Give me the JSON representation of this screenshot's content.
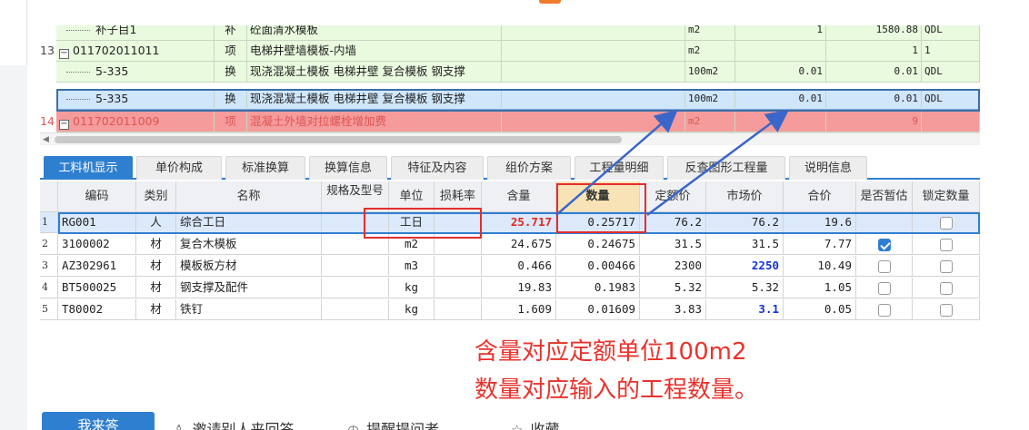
{
  "upper_rows": [
    {
      "num": "",
      "code": "补子目1",
      "type": "补",
      "name": "砼面清水模板",
      "unit": "m2",
      "qty_exp": "1",
      "qty": "1580.88",
      "extra": "QDL",
      "style": "green",
      "indent": true
    },
    {
      "num": "13",
      "code": "011702011011",
      "type": "项",
      "name": "电梯井壁墙模板-内墙",
      "unit": "m2",
      "qty_exp": "",
      "qty": "1",
      "extra": "1",
      "style": "green",
      "tree": true
    },
    {
      "num": "",
      "code": "5-335",
      "type": "换",
      "name": "现浇混凝土模板 电梯井壁 复合模板 钢支撑",
      "unit": "100m2",
      "qty_exp": "0.01",
      "qty": "0.01",
      "extra": "QDL",
      "style": "green",
      "indent": true
    },
    {
      "num": "",
      "code": "5-335",
      "type": "换",
      "name": "现浇混凝土模板 电梯井壁 复合模板 钢支撑",
      "unit": "100m2",
      "qty_exp": "0.01",
      "qty": "0.01",
      "extra": "QDL",
      "style": "sel",
      "indent": true
    },
    {
      "num": "14",
      "code": "011702011009",
      "type": "项",
      "name": "混凝土外墙对拉螺栓增加费",
      "unit": "m2",
      "qty_exp": "",
      "qty": "9",
      "extra": "",
      "style": "red",
      "tree": true
    }
  ],
  "tabs": [
    "工料机显示",
    "单价构成",
    "标准换算",
    "换算信息",
    "特征及内容",
    "组价方案",
    "工程量明细",
    "反查图形工程量",
    "说明信息"
  ],
  "table": {
    "headers": {
      "code": "编码",
      "cat": "类别",
      "name": "名称",
      "spec": "规格及型号",
      "unit": "单位",
      "loss": "损耗率",
      "content": "含量",
      "qty": "数量",
      "quota": "定额价",
      "market": "市场价",
      "total": "合价",
      "temp": "是否暂估",
      "lock": "锁定数量"
    },
    "rows": [
      {
        "idx": "1",
        "code": "RG001",
        "cat": "人",
        "name": "综合工日",
        "unit": "工日",
        "content": "25.717",
        "qty": "0.25717",
        "quota": "76.2",
        "market": "76.2",
        "total": "19.6",
        "temp": null,
        "lock": false
      },
      {
        "idx": "2",
        "code": "3100002",
        "cat": "材",
        "name": "复合木模板",
        "unit": "m2",
        "content": "24.675",
        "qty": "0.24675",
        "quota": "31.5",
        "market": "31.5",
        "total": "7.77",
        "temp": true,
        "lock": false
      },
      {
        "idx": "3",
        "code": "AZ302961",
        "cat": "材",
        "name": "模板板方材",
        "unit": "m3",
        "content": "0.466",
        "qty": "0.00466",
        "quota": "2300",
        "market": "2250",
        "total": "10.49",
        "temp": false,
        "lock": false
      },
      {
        "idx": "4",
        "code": "BT500025",
        "cat": "材",
        "name": "钢支撑及配件",
        "unit": "kg",
        "content": "19.83",
        "qty": "0.1983",
        "quota": "5.32",
        "market": "5.32",
        "total": "1.05",
        "temp": false,
        "lock": false
      },
      {
        "idx": "5",
        "code": "T80002",
        "cat": "材",
        "name": "铁钉",
        "unit": "kg",
        "content": "1.609",
        "qty": "0.01609",
        "quota": "3.83",
        "market": "3.1",
        "total": "0.05",
        "temp": false,
        "lock": false
      }
    ]
  },
  "annotation": {
    "line1": "含量对应定额单位100m2",
    "line2": "数量对应输入的工程数量。"
  },
  "bottom_bar": {
    "answer_label": "我来答",
    "invite_label": "邀请别人来回答",
    "remind_label": "提醒提问者",
    "favorite_label": "收藏"
  },
  "colors": {
    "accent_blue": "#2f7fd1",
    "annotation_red": "#e8332c",
    "row_green": "#e9fadf",
    "row_red": "#f59b9b"
  }
}
